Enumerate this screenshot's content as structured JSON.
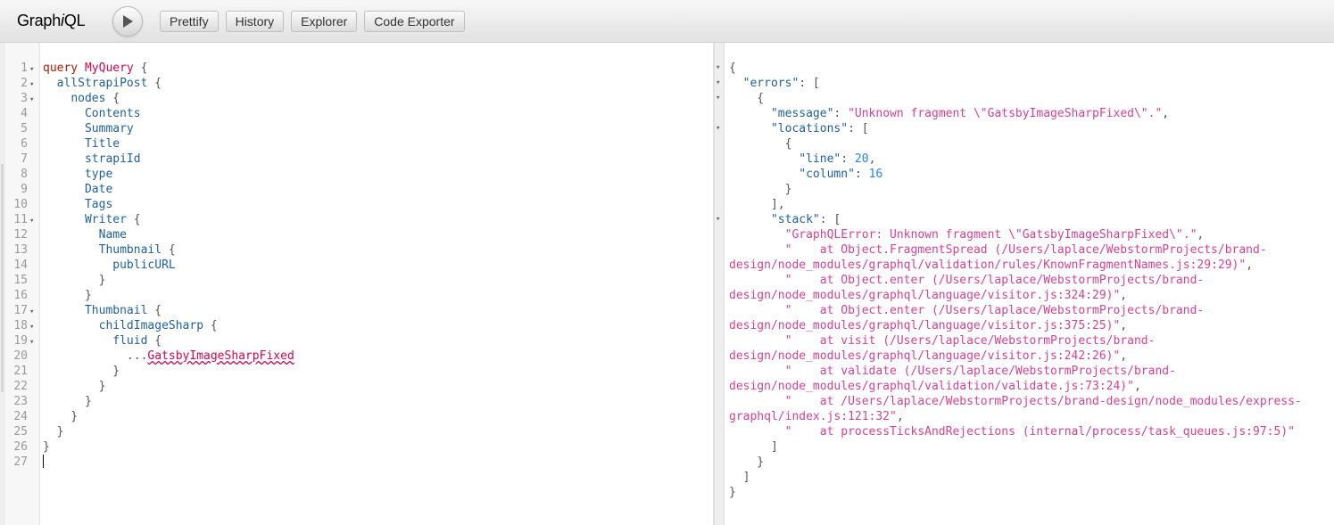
{
  "toolbar": {
    "logo_prefix": "Graph",
    "logo_italic": "i",
    "logo_suffix": "QL",
    "buttons": {
      "prettify": "Prettify",
      "history": "History",
      "explorer": "Explorer",
      "code_exporter": "Code Exporter"
    }
  },
  "query_editor": {
    "lines": [
      {
        "n": "1",
        "fold": "▾",
        "t": [
          {
            "c": "kw",
            "s": "query "
          },
          {
            "c": "def",
            "s": "MyQuery"
          },
          {
            "c": "punc",
            "s": " {"
          }
        ]
      },
      {
        "n": "2",
        "fold": "▾",
        "t": [
          {
            "c": "punc",
            "s": "  "
          },
          {
            "c": "fld",
            "s": "allStrapiPost"
          },
          {
            "c": "punc",
            "s": " {"
          }
        ]
      },
      {
        "n": "3",
        "fold": "▾",
        "t": [
          {
            "c": "punc",
            "s": "    "
          },
          {
            "c": "fld",
            "s": "nodes"
          },
          {
            "c": "punc",
            "s": " {"
          }
        ]
      },
      {
        "n": "4",
        "fold": "",
        "t": [
          {
            "c": "punc",
            "s": "      "
          },
          {
            "c": "fld",
            "s": "Contents"
          }
        ]
      },
      {
        "n": "5",
        "fold": "",
        "t": [
          {
            "c": "punc",
            "s": "      "
          },
          {
            "c": "fld",
            "s": "Summary"
          }
        ]
      },
      {
        "n": "6",
        "fold": "",
        "t": [
          {
            "c": "punc",
            "s": "      "
          },
          {
            "c": "fld",
            "s": "Title"
          }
        ]
      },
      {
        "n": "7",
        "fold": "",
        "t": [
          {
            "c": "punc",
            "s": "      "
          },
          {
            "c": "fld",
            "s": "strapiId"
          }
        ]
      },
      {
        "n": "8",
        "fold": "",
        "t": [
          {
            "c": "punc",
            "s": "      "
          },
          {
            "c": "fld",
            "s": "type"
          }
        ]
      },
      {
        "n": "9",
        "fold": "",
        "t": [
          {
            "c": "punc",
            "s": "      "
          },
          {
            "c": "fld",
            "s": "Date"
          }
        ]
      },
      {
        "n": "10",
        "fold": "",
        "t": [
          {
            "c": "punc",
            "s": "      "
          },
          {
            "c": "fld",
            "s": "Tags"
          }
        ]
      },
      {
        "n": "11",
        "fold": "▾",
        "t": [
          {
            "c": "punc",
            "s": "      "
          },
          {
            "c": "fld",
            "s": "Writer"
          },
          {
            "c": "punc",
            "s": " {"
          }
        ]
      },
      {
        "n": "12",
        "fold": "",
        "t": [
          {
            "c": "punc",
            "s": "        "
          },
          {
            "c": "fld",
            "s": "Name"
          }
        ]
      },
      {
        "n": "13",
        "fold": "",
        "t": [
          {
            "c": "punc",
            "s": "        "
          },
          {
            "c": "fld",
            "s": "Thumbnail"
          },
          {
            "c": "punc",
            "s": " {"
          }
        ]
      },
      {
        "n": "14",
        "fold": "",
        "t": [
          {
            "c": "punc",
            "s": "          "
          },
          {
            "c": "fld",
            "s": "publicURL"
          }
        ]
      },
      {
        "n": "15",
        "fold": "",
        "t": [
          {
            "c": "punc",
            "s": "        }"
          }
        ]
      },
      {
        "n": "16",
        "fold": "",
        "t": [
          {
            "c": "punc",
            "s": "      }"
          }
        ]
      },
      {
        "n": "17",
        "fold": "▾",
        "t": [
          {
            "c": "punc",
            "s": "      "
          },
          {
            "c": "fld",
            "s": "Thumbnail"
          },
          {
            "c": "punc",
            "s": " {"
          }
        ]
      },
      {
        "n": "18",
        "fold": "▾",
        "t": [
          {
            "c": "punc",
            "s": "        "
          },
          {
            "c": "fld",
            "s": "childImageSharp"
          },
          {
            "c": "punc",
            "s": " {"
          }
        ]
      },
      {
        "n": "19",
        "fold": "▾",
        "t": [
          {
            "c": "punc",
            "s": "          "
          },
          {
            "c": "fld",
            "s": "fluid"
          },
          {
            "c": "punc",
            "s": " {"
          }
        ]
      },
      {
        "n": "20",
        "fold": "",
        "t": [
          {
            "c": "punc",
            "s": "            ..."
          },
          {
            "c": "err",
            "s": "GatsbyImageSharpFixed"
          }
        ]
      },
      {
        "n": "21",
        "fold": "",
        "t": [
          {
            "c": "punc",
            "s": "          }"
          }
        ]
      },
      {
        "n": "22",
        "fold": "",
        "t": [
          {
            "c": "punc",
            "s": "        }"
          }
        ]
      },
      {
        "n": "23",
        "fold": "",
        "t": [
          {
            "c": "punc",
            "s": "      }"
          }
        ]
      },
      {
        "n": "24",
        "fold": "",
        "t": [
          {
            "c": "punc",
            "s": "    }"
          }
        ]
      },
      {
        "n": "25",
        "fold": "",
        "t": [
          {
            "c": "punc",
            "s": "  }"
          }
        ]
      },
      {
        "n": "26",
        "fold": "",
        "t": [
          {
            "c": "punc",
            "s": "}"
          }
        ]
      },
      {
        "n": "27",
        "fold": "",
        "t": [],
        "cursor": true
      }
    ]
  },
  "result_viewer": {
    "lines": [
      {
        "fold": "▾",
        "t": [
          {
            "c": "jpunc",
            "s": "{"
          }
        ]
      },
      {
        "fold": "▾",
        "t": [
          {
            "c": "jpunc",
            "s": "  "
          },
          {
            "c": "jkey",
            "s": "\"errors\""
          },
          {
            "c": "jpunc",
            "s": ": ["
          }
        ]
      },
      {
        "fold": "▾",
        "t": [
          {
            "c": "jpunc",
            "s": "    {"
          }
        ]
      },
      {
        "fold": "",
        "t": [
          {
            "c": "jpunc",
            "s": "      "
          },
          {
            "c": "jkey",
            "s": "\"message\""
          },
          {
            "c": "jpunc",
            "s": ": "
          },
          {
            "c": "jstr",
            "s": "\"Unknown fragment \\\"GatsbyImageSharpFixed\\\".\""
          },
          {
            "c": "jpunc",
            "s": ","
          }
        ]
      },
      {
        "fold": "▾",
        "t": [
          {
            "c": "jpunc",
            "s": "      "
          },
          {
            "c": "jkey",
            "s": "\"locations\""
          },
          {
            "c": "jpunc",
            "s": ": ["
          }
        ]
      },
      {
        "fold": "",
        "t": [
          {
            "c": "jpunc",
            "s": "        {"
          }
        ]
      },
      {
        "fold": "",
        "t": [
          {
            "c": "jpunc",
            "s": "          "
          },
          {
            "c": "jkey",
            "s": "\"line\""
          },
          {
            "c": "jpunc",
            "s": ": "
          },
          {
            "c": "jnum",
            "s": "20"
          },
          {
            "c": "jpunc",
            "s": ","
          }
        ]
      },
      {
        "fold": "",
        "t": [
          {
            "c": "jpunc",
            "s": "          "
          },
          {
            "c": "jkey",
            "s": "\"column\""
          },
          {
            "c": "jpunc",
            "s": ": "
          },
          {
            "c": "jnum",
            "s": "16"
          }
        ]
      },
      {
        "fold": "",
        "t": [
          {
            "c": "jpunc",
            "s": "        }"
          }
        ]
      },
      {
        "fold": "",
        "t": [
          {
            "c": "jpunc",
            "s": "      ],"
          }
        ]
      },
      {
        "fold": "▾",
        "t": [
          {
            "c": "jpunc",
            "s": "      "
          },
          {
            "c": "jkey",
            "s": "\"stack\""
          },
          {
            "c": "jpunc",
            "s": ": ["
          }
        ]
      },
      {
        "fold": "",
        "t": [
          {
            "c": "jpunc",
            "s": "        "
          },
          {
            "c": "jstr",
            "s": "\"GraphQLError: Unknown fragment \\\"GatsbyImageSharpFixed\\\".\""
          },
          {
            "c": "jpunc",
            "s": ","
          }
        ]
      },
      {
        "fold": "",
        "t": [
          {
            "c": "jpunc",
            "s": "        "
          },
          {
            "c": "jstr",
            "s": "\"    at Object.FragmentSpread (/Users/laplace/WebstormProjects/brand-"
          }
        ]
      },
      {
        "fold": "",
        "t": [
          {
            "c": "jstr",
            "s": "design/node_modules/graphql/validation/rules/KnownFragmentNames.js:29:29)\""
          },
          {
            "c": "jpunc",
            "s": ","
          }
        ]
      },
      {
        "fold": "",
        "t": [
          {
            "c": "jpunc",
            "s": "        "
          },
          {
            "c": "jstr",
            "s": "\"    at Object.enter (/Users/laplace/WebstormProjects/brand-"
          }
        ]
      },
      {
        "fold": "",
        "t": [
          {
            "c": "jstr",
            "s": "design/node_modules/graphql/language/visitor.js:324:29)\""
          },
          {
            "c": "jpunc",
            "s": ","
          }
        ]
      },
      {
        "fold": "",
        "t": [
          {
            "c": "jpunc",
            "s": "        "
          },
          {
            "c": "jstr",
            "s": "\"    at Object.enter (/Users/laplace/WebstormProjects/brand-"
          }
        ]
      },
      {
        "fold": "",
        "t": [
          {
            "c": "jstr",
            "s": "design/node_modules/graphql/language/visitor.js:375:25)\""
          },
          {
            "c": "jpunc",
            "s": ","
          }
        ]
      },
      {
        "fold": "",
        "t": [
          {
            "c": "jpunc",
            "s": "        "
          },
          {
            "c": "jstr",
            "s": "\"    at visit (/Users/laplace/WebstormProjects/brand-"
          }
        ]
      },
      {
        "fold": "",
        "t": [
          {
            "c": "jstr",
            "s": "design/node_modules/graphql/language/visitor.js:242:26)\""
          },
          {
            "c": "jpunc",
            "s": ","
          }
        ]
      },
      {
        "fold": "",
        "t": [
          {
            "c": "jpunc",
            "s": "        "
          },
          {
            "c": "jstr",
            "s": "\"    at validate (/Users/laplace/WebstormProjects/brand-"
          }
        ]
      },
      {
        "fold": "",
        "t": [
          {
            "c": "jstr",
            "s": "design/node_modules/graphql/validation/validate.js:73:24)\""
          },
          {
            "c": "jpunc",
            "s": ","
          }
        ]
      },
      {
        "fold": "",
        "t": [
          {
            "c": "jpunc",
            "s": "        "
          },
          {
            "c": "jstr",
            "s": "\"    at /Users/laplace/WebstormProjects/brand-design/node_modules/express-"
          }
        ]
      },
      {
        "fold": "",
        "t": [
          {
            "c": "jstr",
            "s": "graphql/index.js:121:32\""
          },
          {
            "c": "jpunc",
            "s": ","
          }
        ]
      },
      {
        "fold": "",
        "t": [
          {
            "c": "jpunc",
            "s": "        "
          },
          {
            "c": "jstr",
            "s": "\"    at processTicksAndRejections (internal/process/task_queues.js:97:5)\""
          }
        ]
      },
      {
        "fold": "",
        "t": [
          {
            "c": "jpunc",
            "s": "      ]"
          }
        ]
      },
      {
        "fold": "",
        "t": [
          {
            "c": "jpunc",
            "s": "    }"
          }
        ]
      },
      {
        "fold": "",
        "t": [
          {
            "c": "jpunc",
            "s": "  ]"
          }
        ]
      },
      {
        "fold": "",
        "t": [
          {
            "c": "jpunc",
            "s": "}"
          }
        ]
      }
    ]
  }
}
